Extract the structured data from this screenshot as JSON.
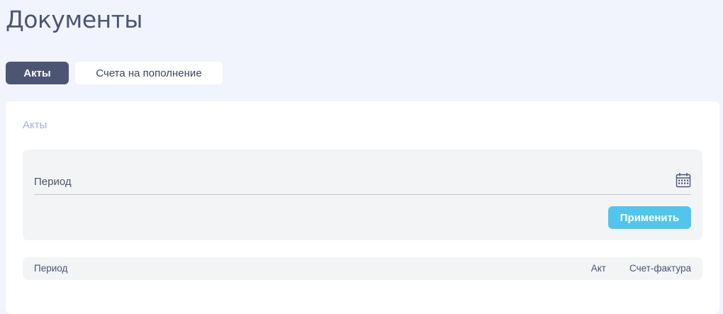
{
  "page": {
    "title": "Документы"
  },
  "tabs": [
    {
      "label": "Акты",
      "active": true
    },
    {
      "label": "Счета на пополнение",
      "active": false
    }
  ],
  "card": {
    "title": "Акты",
    "filter": {
      "period_label": "Период",
      "calendar_icon": "calendar-icon",
      "apply_label": "Применить"
    },
    "table": {
      "columns": [
        "Период",
        "Акт",
        "Счет-фактура"
      ]
    }
  },
  "colors": {
    "background": "#f1f4fd",
    "active_tab": "#4c5672",
    "apply_button": "#51c6ec",
    "panel": "#f3f4f6",
    "title_text": "#4a5573",
    "muted_text": "#a6b0c6"
  }
}
